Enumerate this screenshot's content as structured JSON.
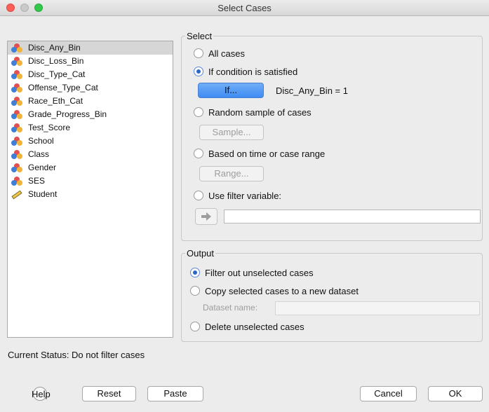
{
  "window": {
    "title": "Select Cases"
  },
  "variables": [
    {
      "name": "Disc_Any_Bin",
      "type": "nominal",
      "selected": true
    },
    {
      "name": "Disc_Loss_Bin",
      "type": "nominal"
    },
    {
      "name": "Disc_Type_Cat",
      "type": "nominal"
    },
    {
      "name": "Offense_Type_Cat",
      "type": "nominal"
    },
    {
      "name": "Race_Eth_Cat",
      "type": "nominal"
    },
    {
      "name": "Grade_Progress_Bin",
      "type": "nominal"
    },
    {
      "name": "Test_Score",
      "type": "nominal"
    },
    {
      "name": "School",
      "type": "nominal"
    },
    {
      "name": "Class",
      "type": "nominal"
    },
    {
      "name": "Gender",
      "type": "nominal"
    },
    {
      "name": "SES",
      "type": "nominal"
    },
    {
      "name": "Student",
      "type": "scale"
    }
  ],
  "select": {
    "label": "Select",
    "all_cases": "All cases",
    "if_condition": "If condition is satisfied",
    "if_button": "If...",
    "condition": "Disc_Any_Bin = 1",
    "random_sample": "Random sample of cases",
    "sample_button": "Sample...",
    "time_range": "Based on time or case range",
    "range_button": "Range...",
    "filter_variable": "Use filter variable:",
    "filter_value": ""
  },
  "output": {
    "label": "Output",
    "filter_out": "Filter out unselected cases",
    "copy_selected": "Copy selected cases to a new dataset",
    "dataset_name_label": "Dataset name:",
    "dataset_name_value": "",
    "delete_unselected": "Delete unselected cases"
  },
  "status": "Current Status: Do not filter cases",
  "buttons": {
    "help": "Help",
    "reset": "Reset",
    "paste": "Paste",
    "cancel": "Cancel",
    "ok": "OK"
  },
  "colors": {
    "accent": "#3e8cf3",
    "window_bg": "#ececec",
    "close": "#fc5f57",
    "maximize": "#34c84a"
  }
}
